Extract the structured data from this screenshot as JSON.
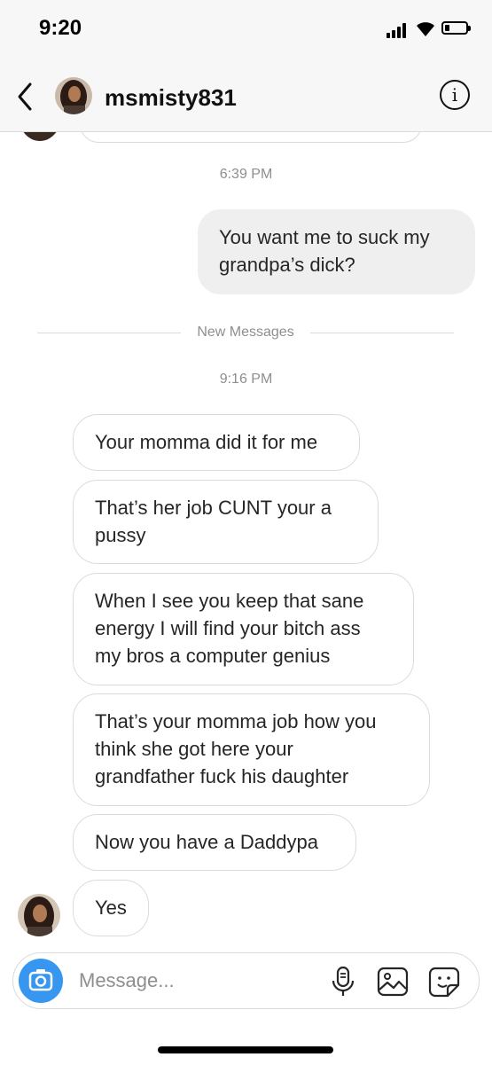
{
  "status_bar": {
    "time": "9:20"
  },
  "header": {
    "username": "msmisty831",
    "info_label": "i"
  },
  "conversation": {
    "timestamp_1": "6:39 PM",
    "outgoing_message": [
      "You want me to suck my",
      "grandpa’s dick?"
    ],
    "new_messages_label": "New Messages",
    "timestamp_2": "9:16 PM",
    "incoming_messages": [
      {
        "lines": [
          "Your momma did it for me"
        ]
      },
      {
        "lines": [
          "That’s her job CUNT your a",
          "pussy"
        ]
      },
      {
        "lines": [
          "When I see you keep that sane",
          "energy I will find your bitch ass",
          "my bros a computer genius"
        ]
      },
      {
        "lines": [
          "That’s your momma job how you",
          "think she got here your",
          "grandfather fuck his daughter"
        ]
      },
      {
        "lines": [
          "Now you have a Daddypa"
        ]
      },
      {
        "lines": [
          "Yes"
        ]
      }
    ]
  },
  "composer": {
    "placeholder": "Message..."
  },
  "icons": [
    "back-chevron-icon",
    "info-icon",
    "camera-icon",
    "microphone-icon",
    "gallery-icon",
    "sticker-icon"
  ],
  "colors": {
    "accent": "#3797f0",
    "outgoing_bubble": "#efefef",
    "bubble_border": "#dbdbdb",
    "muted_text": "#8e8e8e"
  }
}
